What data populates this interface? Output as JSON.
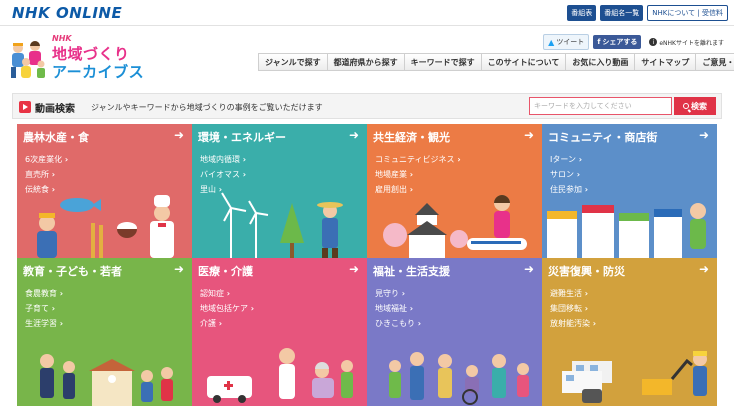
{
  "topbar": {
    "logo": "NHK ONLINE",
    "links": [
      "番組表",
      "番組名一覧",
      "NHKについて | 受信料"
    ]
  },
  "header": {
    "logo_nhk": "NHK",
    "logo_line1": "地域づくり",
    "logo_line2": "アーカイブス",
    "tweet_label": "ツイート",
    "share_label": "シェアする",
    "exit_note": "eNHKサイトを離れます",
    "nav": [
      "ジャンルで探す",
      "都道府県から探す",
      "キーワードで探す",
      "このサイトについて",
      "お気に入り動画",
      "サイトマップ",
      "ご意見・ご感想"
    ]
  },
  "search": {
    "title": "動画検索",
    "description": "ジャンルやキーワードから地域づくりの事例をご覧いただけます",
    "placeholder": "キーワードを入力してください",
    "button": "検索"
  },
  "colors": {
    "agri": "#e06a69",
    "energy": "#3aaeaa",
    "economy": "#ec7b45",
    "community": "#5c8fc9",
    "education": "#78b54a",
    "medical": "#e7557d",
    "welfare": "#7a79c7",
    "disaster": "#d2a13d"
  },
  "tiles": [
    {
      "key": "agri",
      "title": "農林水産・食",
      "links": [
        "6次産業化",
        "直売所",
        "伝統食"
      ],
      "icon": "farmer-fish-chef-icon"
    },
    {
      "key": "energy",
      "title": "環境・エネルギー",
      "links": [
        "地域内循環",
        "バイオマス",
        "里山"
      ],
      "icon": "windmill-tree-icon"
    },
    {
      "key": "economy",
      "title": "共生経済・観光",
      "links": [
        "コミュニティビジネス",
        "地場産業",
        "雇用創出"
      ],
      "icon": "castle-train-icon"
    },
    {
      "key": "community",
      "title": "コミュニティ・商店街",
      "links": [
        "Iターン",
        "サロン",
        "住民参加"
      ],
      "icon": "shop-street-icon"
    },
    {
      "key": "education",
      "title": "教育・子ども・若者",
      "links": [
        "食農教育",
        "子育て",
        "生涯学習"
      ],
      "icon": "school-kids-icon"
    },
    {
      "key": "medical",
      "title": "医療・介護",
      "links": [
        "認知症",
        "地域包括ケア",
        "介護"
      ],
      "icon": "ambulance-nurse-icon"
    },
    {
      "key": "welfare",
      "title": "福祉・生活支援",
      "links": [
        "見守り",
        "地域福祉",
        "ひきこもり"
      ],
      "icon": "family-wheelchair-icon"
    },
    {
      "key": "disaster",
      "title": "災害復興・防災",
      "links": [
        "避難生活",
        "集団移転",
        "放射能汚染"
      ],
      "icon": "temporary-housing-icon"
    }
  ]
}
